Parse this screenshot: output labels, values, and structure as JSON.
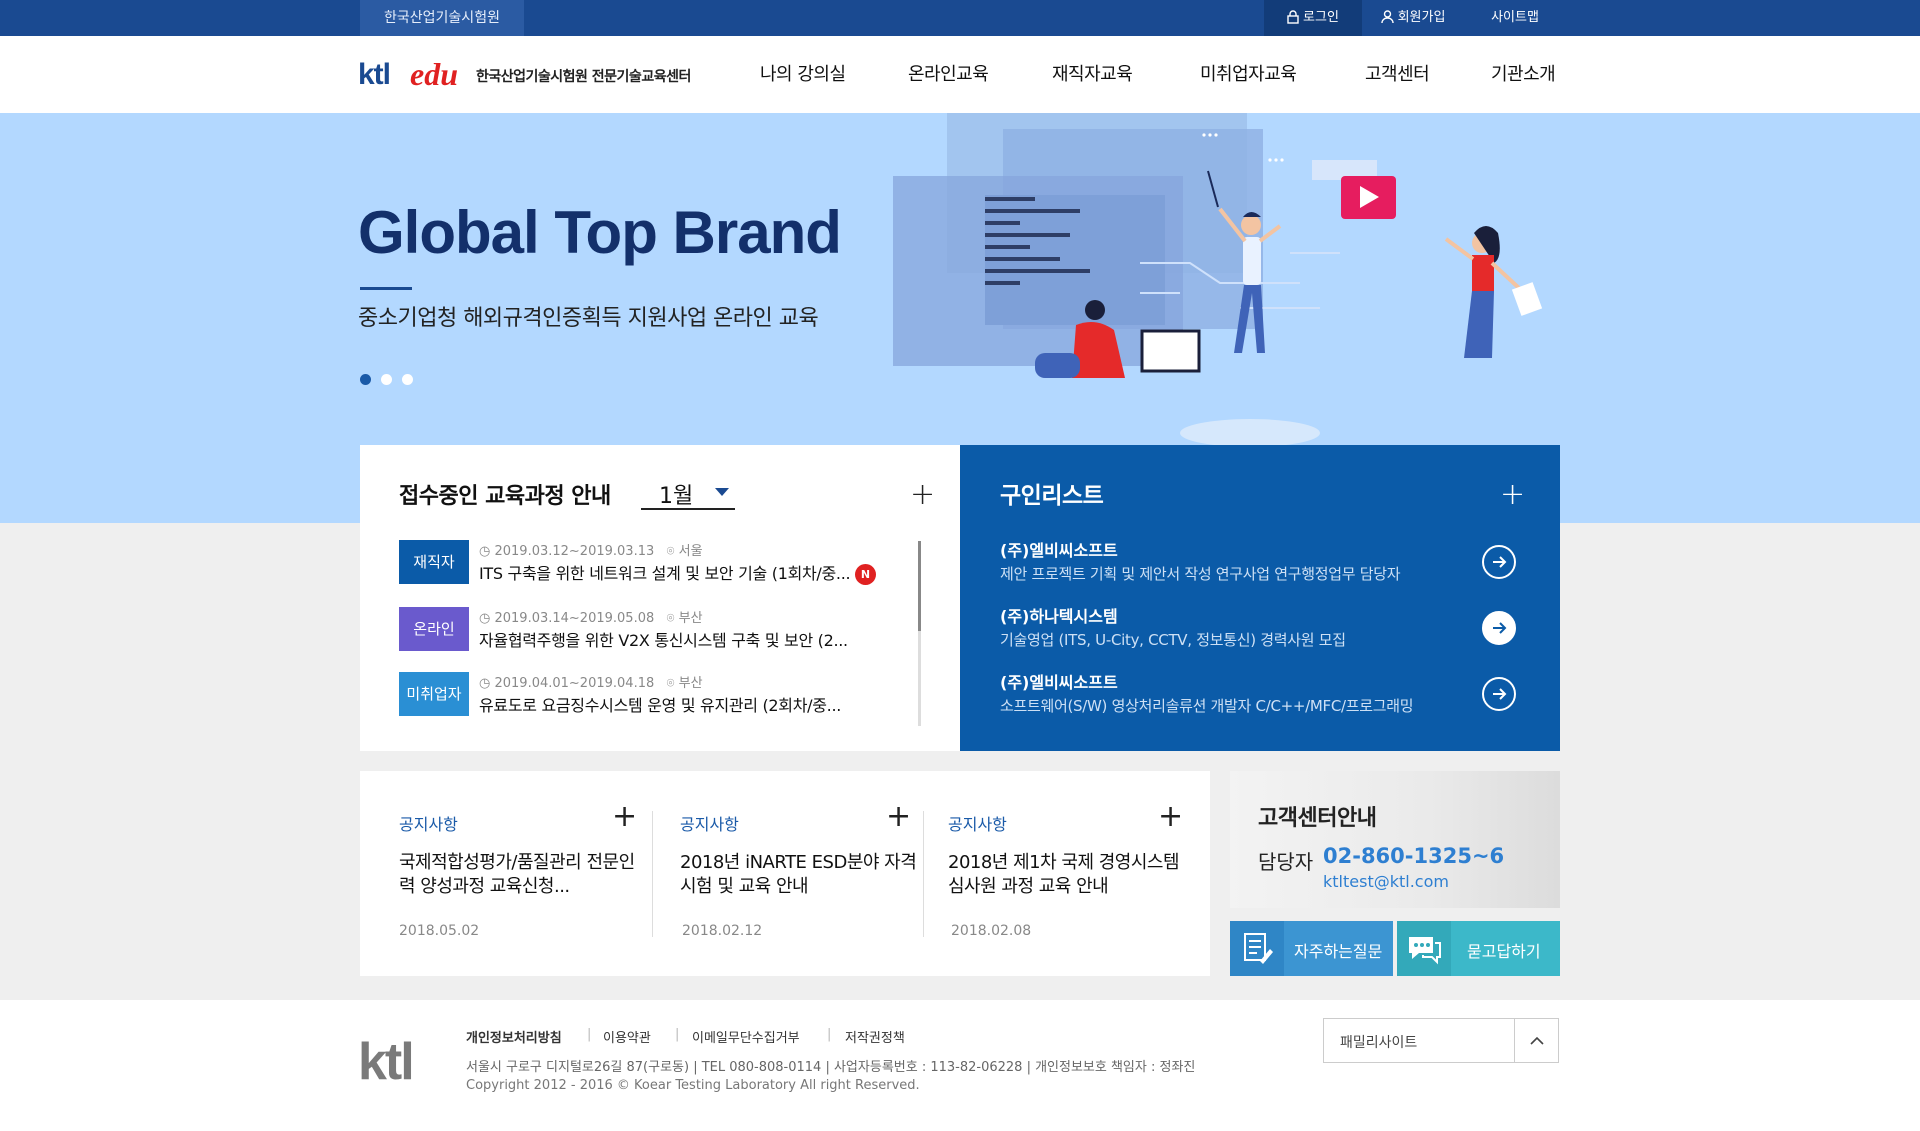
{
  "topbar": {
    "site_name": "한국산업기술시험원",
    "login": "로그인",
    "join": "회원가입",
    "sitemap": "사이트맵"
  },
  "header": {
    "logo_ktl": "ktl",
    "logo_edu": "edu",
    "logo_text": "한국산업기술시험원 전문기술교육센터",
    "nav": [
      "나의 강의실",
      "온라인교육",
      "재직자교육",
      "미취업자교육",
      "고객센터",
      "기관소개"
    ]
  },
  "hero": {
    "title": "Global Top Brand",
    "subtitle": "중소기업청 해외규격인증획득 지원사업 온라인 교육",
    "slides_total": 3,
    "slide_active": 1
  },
  "courses": {
    "title": "접수중인 교육과정 안내",
    "month": "1월",
    "more": "+",
    "items": [
      {
        "type": "재직자",
        "color": "#0b5ba8",
        "date": "2019.03.12~2019.03.13",
        "place": "서울",
        "title": "ITS 구축을 위한 네트워크 설계 및 보안 기술 (1회차/중...",
        "new": "N"
      },
      {
        "type": "온라인",
        "color": "#6a5acd",
        "date": "2019.03.14~2019.05.08",
        "place": "부산",
        "title": "자율협력주행을 위한 V2X 통신시스템 구축 및 보안 (2..."
      },
      {
        "type": "미취업자",
        "color": "#2a8fd4",
        "date": "2019.04.01~2019.04.18",
        "place": "부산",
        "title": "유료도로 요금징수시스템 운영 및 유지관리 (2회차/중..."
      }
    ]
  },
  "jobs": {
    "title": "구인리스트",
    "more": "+",
    "items": [
      {
        "company": "(주)엘비씨소프트",
        "desc": "제안 프로젝트 기획 및 제안서 작성 연구사업 연구행정업무 담당자"
      },
      {
        "company": "(주)하나텍시스템",
        "desc": "기술영업 (ITS, U-City, CCTV, 정보통신) 경력사원 모집"
      },
      {
        "company": "(주)엘비씨소프트",
        "desc": "소프트웨어(S/W) 영상처리솔류션 개발자 C/C++/MFC/프로그래밍"
      }
    ]
  },
  "notices": [
    {
      "label": "공지사항",
      "title": "국제적합성평가/품질관리 전문인력 양성과정 교육신청...",
      "date": "2018.05.02"
    },
    {
      "label": "공지사항",
      "title": "2018년 iNARTE ESD분야 자격시험 및 교육 안내",
      "date": "2018.02.12"
    },
    {
      "label": "공지사항",
      "title": "2018년 제1차 국제 경영시스템 심사원 과정 교육 안내",
      "date": "2018.02.08"
    }
  ],
  "customer": {
    "title": "고객센터안내",
    "label": "담당자",
    "phone": "02-860-1325~6",
    "email": "ktltest@ktl.com",
    "faq": "자주하는질문",
    "qna": "묻고답하기"
  },
  "footer": {
    "logo": "ktl",
    "links": [
      "개인정보처리방침",
      "이용약관",
      "이메일무단수집거부",
      "저작권정책"
    ],
    "info": "서울시 구로구 디지털로26길 87(구로동)   |   TEL 080-808-0114   |   사업자등록번호 : 113-82-06228   |   개인정보보호 책임자 : 정좌진",
    "copyright": "Copyright 2012 - 2016 © Koear Testing Laboratory All right Reserved.",
    "family_site": "패밀리사이트"
  },
  "colors": {
    "brand_blue": "#1a4a91",
    "hero_bg": "#b3d8ff",
    "job_bg": "#0b5ba8",
    "accent_red": "#e02121"
  }
}
